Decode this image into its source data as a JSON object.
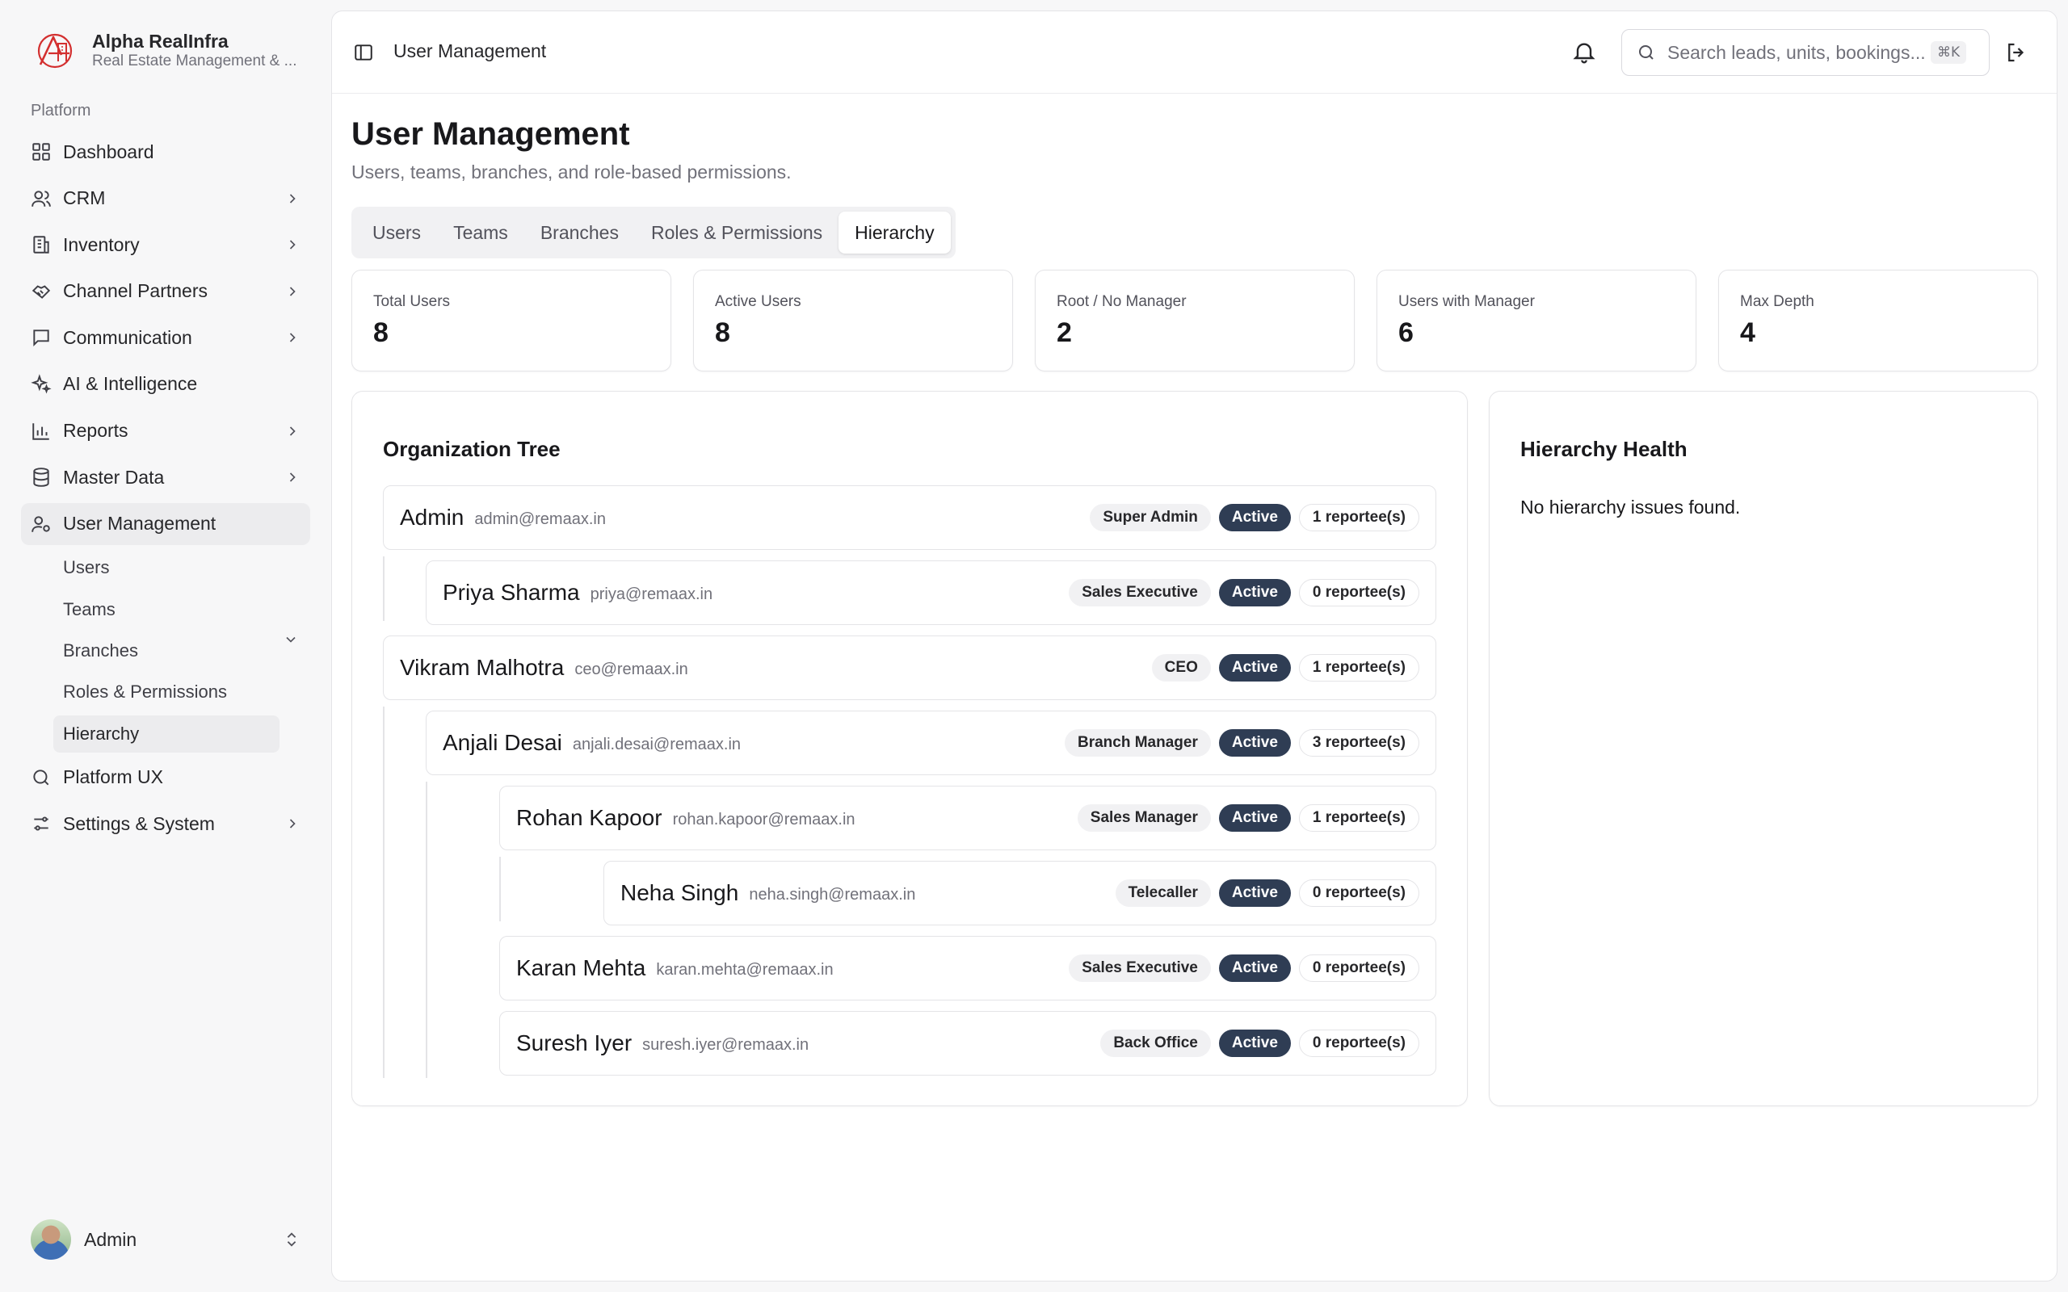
{
  "brand": {
    "name": "Alpha RealInfra",
    "subtitle": "Real Estate Management & ...",
    "accent": "#d32f2f"
  },
  "sidebar": {
    "section_label": "Platform",
    "items": [
      {
        "label": "Dashboard",
        "icon": "grid-icon",
        "has_chevron": false
      },
      {
        "label": "CRM",
        "icon": "users-icon",
        "has_chevron": true
      },
      {
        "label": "Inventory",
        "icon": "building-icon",
        "has_chevron": true
      },
      {
        "label": "Channel Partners",
        "icon": "handshake-icon",
        "has_chevron": true
      },
      {
        "label": "Communication",
        "icon": "message-icon",
        "has_chevron": true
      },
      {
        "label": "AI & Intelligence",
        "icon": "sparkles-icon",
        "has_chevron": false
      },
      {
        "label": "Reports",
        "icon": "bar-chart-icon",
        "has_chevron": true
      },
      {
        "label": "Master Data",
        "icon": "database-icon",
        "has_chevron": true
      },
      {
        "label": "User Management",
        "icon": "user-cog-icon",
        "has_chevron": true,
        "active": true
      },
      {
        "label": "Platform UX",
        "icon": "search-icon",
        "has_chevron": false
      },
      {
        "label": "Settings & System",
        "icon": "sliders-icon",
        "has_chevron": true
      }
    ],
    "user_management_sub": [
      "Users",
      "Teams",
      "Branches",
      "Roles & Permissions",
      "Hierarchy"
    ],
    "active_sub": "Hierarchy",
    "footer_user": "Admin"
  },
  "topbar": {
    "breadcrumb": "User Management",
    "search_placeholder": "Search leads, units, bookings...",
    "search_shortcut": "⌘K"
  },
  "page": {
    "title": "User Management",
    "subtitle": "Users, teams, branches, and role-based permissions.",
    "tabs": [
      "Users",
      "Teams",
      "Branches",
      "Roles & Permissions",
      "Hierarchy"
    ],
    "active_tab": "Hierarchy"
  },
  "stats": [
    {
      "label": "Total Users",
      "value": "8"
    },
    {
      "label": "Active Users",
      "value": "8"
    },
    {
      "label": "Root / No Manager",
      "value": "2"
    },
    {
      "label": "Users with Manager",
      "value": "6"
    },
    {
      "label": "Max Depth",
      "value": "4"
    }
  ],
  "org_tree": {
    "title": "Organization Tree",
    "nodes": [
      {
        "name": "Admin",
        "email": "admin@remaax.in",
        "role": "Super Admin",
        "status": "Active",
        "reportees": "1 reportee(s)",
        "depth": 0
      },
      {
        "name": "Priya Sharma",
        "email": "priya@remaax.in",
        "role": "Sales Executive",
        "status": "Active",
        "reportees": "0 reportee(s)",
        "depth": 1
      },
      {
        "name": "Vikram Malhotra",
        "email": "ceo@remaax.in",
        "role": "CEO",
        "status": "Active",
        "reportees": "1 reportee(s)",
        "depth": 0
      },
      {
        "name": "Anjali Desai",
        "email": "anjali.desai@remaax.in",
        "role": "Branch Manager",
        "status": "Active",
        "reportees": "3 reportee(s)",
        "depth": 1
      },
      {
        "name": "Rohan Kapoor",
        "email": "rohan.kapoor@remaax.in",
        "role": "Sales Manager",
        "status": "Active",
        "reportees": "1 reportee(s)",
        "depth": 2
      },
      {
        "name": "Neha Singh",
        "email": "neha.singh@remaax.in",
        "role": "Telecaller",
        "status": "Active",
        "reportees": "0 reportee(s)",
        "depth": 3
      },
      {
        "name": "Karan Mehta",
        "email": "karan.mehta@remaax.in",
        "role": "Sales Executive",
        "status": "Active",
        "reportees": "0 reportee(s)",
        "depth": 2
      },
      {
        "name": "Suresh Iyer",
        "email": "suresh.iyer@remaax.in",
        "role": "Back Office",
        "status": "Active",
        "reportees": "0 reportee(s)",
        "depth": 2
      }
    ]
  },
  "health": {
    "title": "Hierarchy Health",
    "message": "No hierarchy issues found."
  },
  "colors": {
    "status_badge": "#2f3d54",
    "sidebar_bg": "#f7f7f8",
    "active_nav": "#ececee"
  }
}
